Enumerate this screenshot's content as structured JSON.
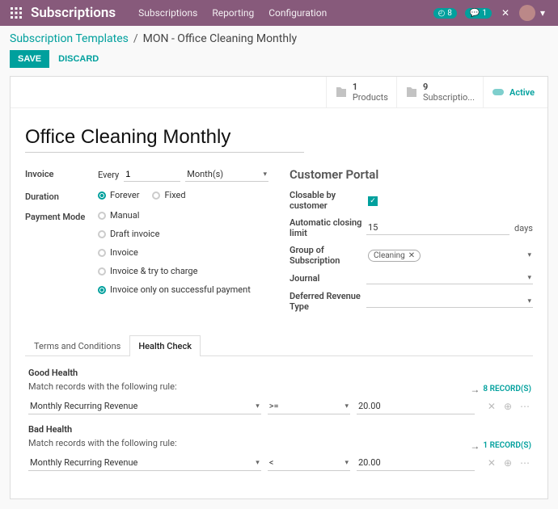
{
  "nav": {
    "brand": "Subscriptions",
    "items": [
      "Subscriptions",
      "Reporting",
      "Configuration"
    ],
    "badge1": "8",
    "badge2": "1"
  },
  "crumb": {
    "parent": "Subscription Templates",
    "current": "MON - Office Cleaning Monthly"
  },
  "actions": {
    "save": "SAVE",
    "discard": "DISCARD"
  },
  "stats": {
    "products": {
      "count": "1",
      "label": "Products"
    },
    "subscriptions": {
      "count": "9",
      "label": "Subscriptio..."
    },
    "active": "Active"
  },
  "form": {
    "title": "Office Cleaning Monthly",
    "invoice_label": "Invoice",
    "every_label": "Every",
    "every_value": "1",
    "every_unit": "Month(s)",
    "duration_label": "Duration",
    "duration_opts": {
      "forever": "Forever",
      "fixed": "Fixed"
    },
    "payment_label": "Payment Mode",
    "payment_opts": [
      "Manual",
      "Draft invoice",
      "Invoice",
      "Invoice & try to charge",
      "Invoice only on successful payment"
    ]
  },
  "portal": {
    "head": "Customer Portal",
    "closable_label": "Closable by customer",
    "autoclose_label": "Automatic closing limit",
    "autoclose_value": "15",
    "autoclose_unit": "days",
    "group_label": "Group of Subscription",
    "group_chip": "Cleaning",
    "journal_label": "Journal",
    "deferred_label": "Deferred Revenue Type"
  },
  "tabs": {
    "terms": "Terms and Conditions",
    "health": "Health Check"
  },
  "health": {
    "good_title": "Good Health",
    "good_sub": "Match records with the following rule:",
    "good_records": "8 RECORD(S)",
    "good_field": "Monthly Recurring Revenue",
    "good_op": ">=",
    "good_val": "20.00",
    "bad_title": "Bad Health",
    "bad_sub": "Match records with the following rule:",
    "bad_records": "1 RECORD(S)",
    "bad_field": "Monthly Recurring Revenue",
    "bad_op": "<",
    "bad_val": "20.00"
  }
}
